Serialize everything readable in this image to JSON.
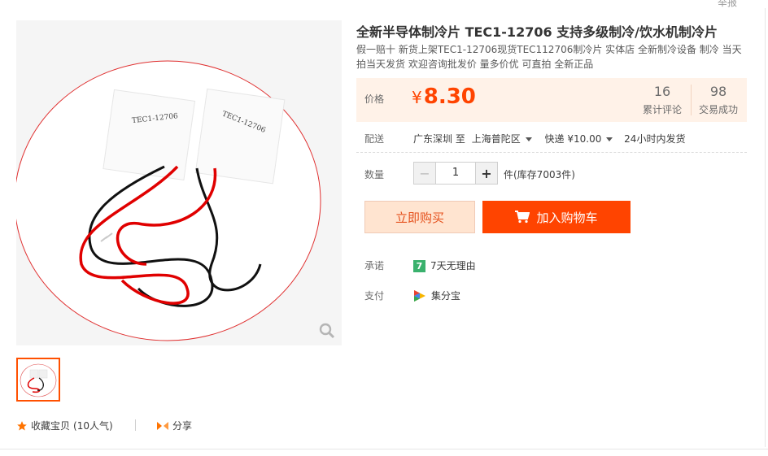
{
  "report_label": "举报",
  "product": {
    "title": "全新半导体制冷片 TEC1-12706 支持多级制冷/饮水机制冷片",
    "subtitle": "假一赔十 新货上架TEC1-12706现货TEC112706制冷片 实体店 全新制冷设备 制冷 当天拍当天发货 欢迎咨询批发价 量多价优 可直拍 全新正品",
    "image_text": [
      "TEC1-12706",
      "TEC1-12706"
    ]
  },
  "price": {
    "label": "价格",
    "currency": "¥",
    "value": "8.30",
    "reviews_count": "16",
    "reviews_label": "累计评论",
    "trades_count": "98",
    "trades_label": "交易成功"
  },
  "shipping": {
    "label": "配送",
    "from": "广东深圳",
    "to_word": "至",
    "to": "上海普陀区",
    "method": "快递 ¥10.00",
    "dispatch": "24小时内发货"
  },
  "quantity": {
    "label": "数量",
    "minus": "−",
    "value": "1",
    "plus": "+",
    "stock": "件(库存7003件)"
  },
  "actions": {
    "buy_now": "立即购买",
    "add_to_cart": "加入购物车"
  },
  "promise": {
    "label": "承诺",
    "badge": "7",
    "text": "7天无理由"
  },
  "payment": {
    "label": "支付",
    "method": "集分宝"
  },
  "footer": {
    "favorite": "收藏宝贝",
    "favorite_count": "(10人气)",
    "share": "分享"
  },
  "colors": {
    "accent": "#ff4400",
    "price_bg": "#fff2e8",
    "buy_bg": "#ffe4d0",
    "badge_green": "#3ab16d",
    "star": "#ff7300"
  },
  "icons": [
    "zoom-icon",
    "cart-icon",
    "star-icon",
    "share-icon",
    "jifenbao-icon",
    "caret-down-icon"
  ]
}
